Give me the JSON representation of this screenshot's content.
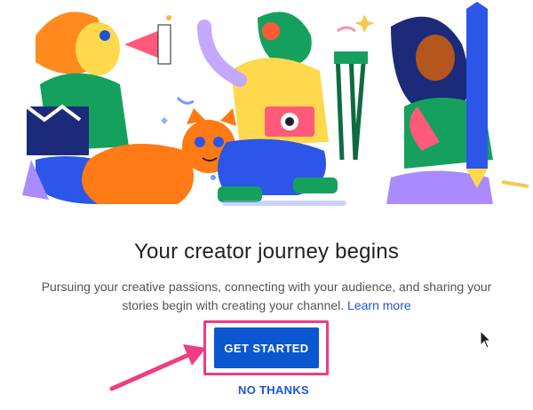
{
  "hero": {
    "illustration": "creator-characters-illustration"
  },
  "content": {
    "title": "Your creator journey begins",
    "description": "Pursuing your creative passions, connecting with your audience, and sharing your stories begin with creating your channel.",
    "learn_more": "Learn more"
  },
  "actions": {
    "get_started": "GET STARTED",
    "no_thanks": "NO THANKS"
  },
  "colors": {
    "primary_blue": "#0b57cf",
    "link_blue": "#1a56d6",
    "highlight_pink": "#f03c82"
  }
}
